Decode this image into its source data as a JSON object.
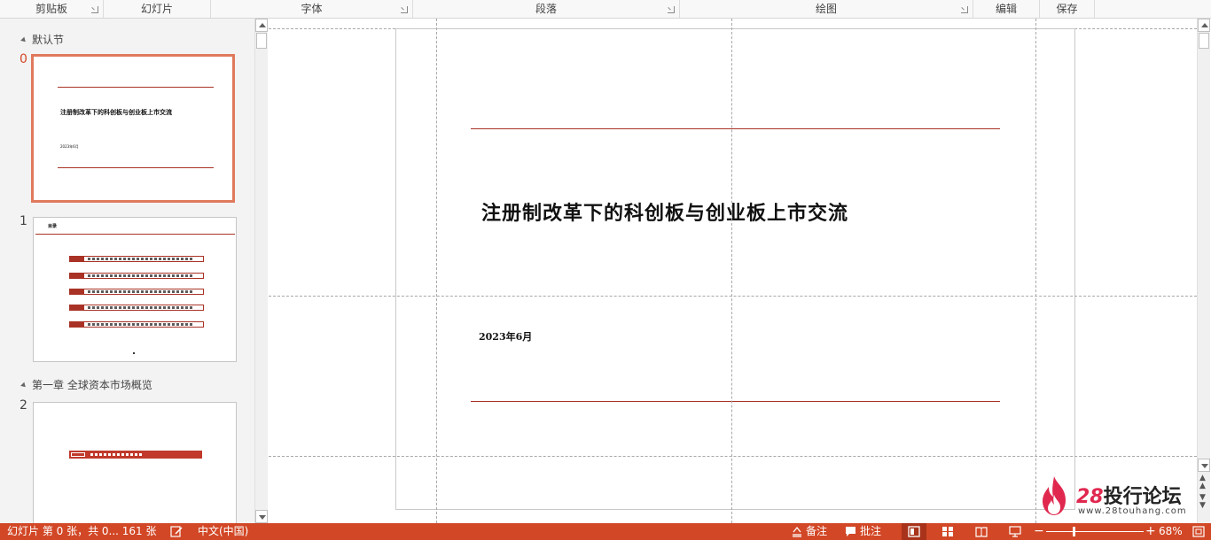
{
  "ribbon": {
    "groups": [
      {
        "label": "剪贴板",
        "launcher": true
      },
      {
        "label": "幻灯片",
        "launcher": false
      },
      {
        "label": "字体",
        "launcher": true
      },
      {
        "label": "段落",
        "launcher": true
      },
      {
        "label": "绘图",
        "launcher": true
      },
      {
        "label": "编辑",
        "launcher": false
      },
      {
        "label": "保存",
        "launcher": false
      }
    ]
  },
  "thumbnails": {
    "sections": [
      {
        "label": "默认节"
      },
      {
        "label": "第一章 全球资本市场概览"
      }
    ],
    "slides": [
      {
        "number": "0",
        "title": "注册制改革下的科创板与创业板上市交流",
        "date": "2023年6月"
      },
      {
        "number": "1",
        "title": "目录"
      },
      {
        "number": "2"
      }
    ]
  },
  "slide": {
    "title": "注册制改革下的科创板与创业板上市交流",
    "date": "2023年6月"
  },
  "watermark": {
    "number": "28",
    "name": "投行论坛",
    "url": "www.28touhang.com"
  },
  "status_bar": {
    "slide_info": "幻灯片 第 0 张，共 0... 161 张",
    "language": "中文(中国)",
    "notes_label": "备注",
    "comments_label": "批注",
    "zoom_minus": "−",
    "zoom_plus": "+",
    "zoom_level": "68%"
  },
  "colors": {
    "accent": "#d24726",
    "slide_line": "#a93226",
    "selection_border": "#e0795c"
  }
}
